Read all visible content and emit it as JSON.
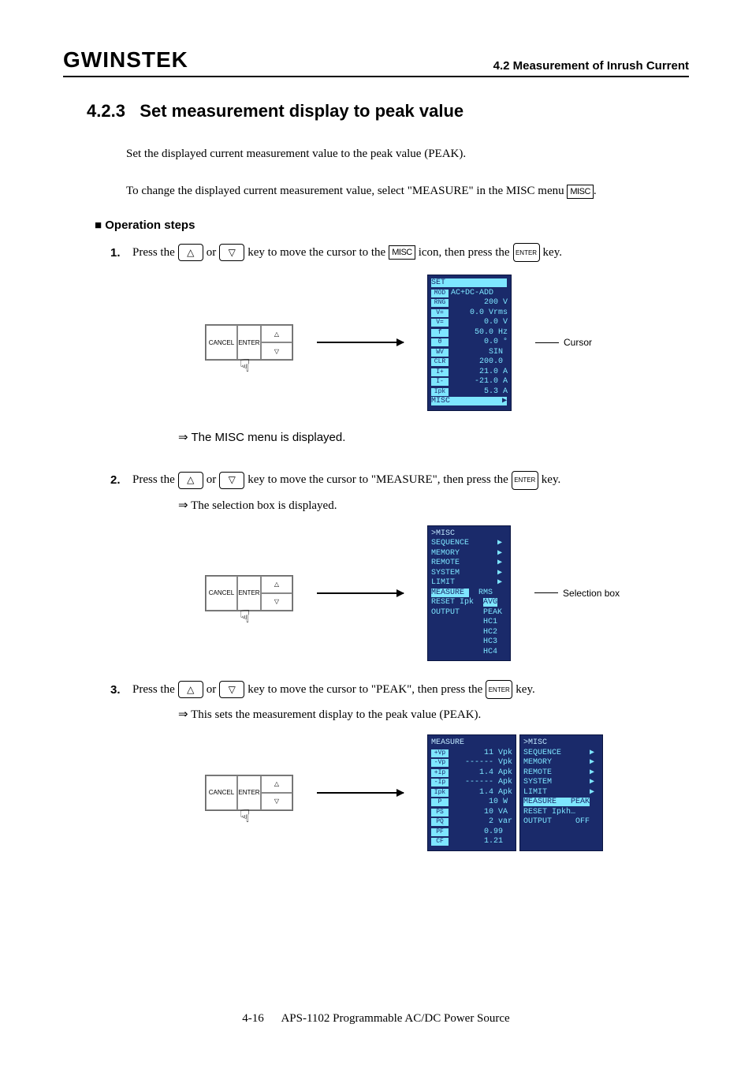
{
  "header": {
    "logo": "GWINSTEK",
    "right": "4.2 Measurement of Inrush Current"
  },
  "section": {
    "number": "4.2.3",
    "title": "Set measurement display to peak value"
  },
  "para1": "Set the displayed current measurement value to the peak value (PEAK).",
  "para2_pre": "To change the displayed current measurement value, select \"MEASURE\" in the MISC menu ",
  "para2_icon": "MISC",
  "para2_post": ".",
  "op_steps_head": "Operation steps",
  "keys": {
    "up": "△",
    "down": "▽",
    "enter": "ENTER",
    "cancel": "CANCEL",
    "misc_icon": "MISC"
  },
  "steps": [
    {
      "num": "1.",
      "t1": "Press the ",
      "t2": " or ",
      "t3": " key to move the cursor to the ",
      "t4": " icon, then press the ",
      "t5": " key.",
      "result": "The MISC menu is displayed."
    },
    {
      "num": "2.",
      "t1": "Press the ",
      "t2": " or ",
      "t3": " key to move the cursor to  \"MEASURE\", then press the ",
      "t5": " key.",
      "result": "The selection box is displayed."
    },
    {
      "num": "3.",
      "t1": "Press the ",
      "t2": " or ",
      "t3": " key to move the cursor to \"PEAK\", then press the ",
      "t5": " key.",
      "result": "This sets the measurement display to the peak value (PEAK)."
    }
  ],
  "labels": {
    "cursor": "Cursor",
    "selection_box": "Selection box"
  },
  "screens": {
    "s1_title": "SET",
    "s1_lines": [
      [
        "MOD",
        "AC+DC-ADD"
      ],
      [
        "RNG",
        "       200 V"
      ],
      [
        "V=",
        "    0.0 Vrms"
      ],
      [
        "V=",
        "       0.0 V"
      ],
      [
        "f",
        "     50.0 Hz"
      ],
      [
        "θ",
        "       0.0 °"
      ],
      [
        "WV",
        "        SIN"
      ],
      [
        "CLR",
        "      200.0"
      ],
      [
        "I+",
        "      21.0 A"
      ],
      [
        "I-",
        "     -21.0 A"
      ],
      [
        "Ipk",
        "       5.3 A"
      ]
    ],
    "s1_misc_row": "MISC           ▶",
    "s2_title": ">MISC",
    "s2_lines": [
      "SEQUENCE      ▶",
      "MEMORY        ▶",
      "REMOTE        ▶",
      "SYSTEM        ▶",
      "LIMIT         ▶"
    ],
    "s2_measure": "MEASURE ",
    "s2_reset": "RESET Ipk",
    "s2_output": "OUTPUT",
    "s2_box": [
      "RMS",
      "AVG",
      "PEAK",
      "HC1",
      "HC2",
      "HC3",
      "HC4"
    ],
    "s3a_title": "MEASURE",
    "s3a_lines": [
      [
        "+Vp",
        "       11 Vpk"
      ],
      [
        "-Vp",
        "   ------ Vpk"
      ],
      [
        "+Ip",
        "      1.4 Apk"
      ],
      [
        "-Ip",
        "   ------ Apk"
      ],
      [
        "Ipk",
        "      1.4 Apk"
      ],
      [
        "P",
        "        10 W"
      ],
      [
        "PS",
        "       10 VA"
      ],
      [
        "PQ",
        "        2 var"
      ],
      [
        "PF",
        "       0.99"
      ],
      [
        "CF",
        "       1.21"
      ]
    ],
    "s3b_title": ">MISC",
    "s3b_lines": [
      "SEQUENCE      ▶",
      "MEMORY        ▶",
      "REMOTE        ▶",
      "SYSTEM        ▶",
      "LIMIT         ▶",
      "MEASURE   PEAK",
      "RESET Ipkh…",
      "OUTPUT     OFF"
    ]
  },
  "footer": {
    "page": "4-16",
    "doc": "APS-1102 Programmable AC/DC Power Source"
  }
}
